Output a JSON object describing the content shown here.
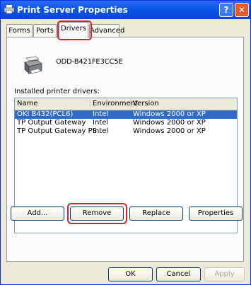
{
  "window": {
    "title": "Print Server Properties",
    "help_label": "?",
    "close_label": "✕"
  },
  "tabs": [
    {
      "label": "Forms"
    },
    {
      "label": "Ports"
    },
    {
      "label": "Drivers",
      "active": true
    },
    {
      "label": "Advanced"
    }
  ],
  "server": {
    "name": "ODD-B421FE3CC5E"
  },
  "drivers": {
    "label": "Installed printer drivers:",
    "columns": [
      "Name",
      "Environment",
      "Version"
    ],
    "rows": [
      {
        "name": "OKI B432(PCL6)",
        "environment": "Intel",
        "version": "Windows 2000 or XP",
        "selected": true
      },
      {
        "name": "TP Output Gateway",
        "environment": "Intel",
        "version": "Windows 2000 or XP"
      },
      {
        "name": "TP Output Gateway PS",
        "environment": "Intel",
        "version": "Windows 2000 or XP"
      }
    ]
  },
  "actions": {
    "add": "Add...",
    "remove": "Remove",
    "replace": "Replace",
    "properties": "Properties"
  },
  "dialog_buttons": {
    "ok": "OK",
    "cancel": "Cancel",
    "apply": "Apply"
  },
  "colors": {
    "highlight": "#e21f26",
    "selection": "#316ac5",
    "titlebar": "#0a58e8"
  }
}
